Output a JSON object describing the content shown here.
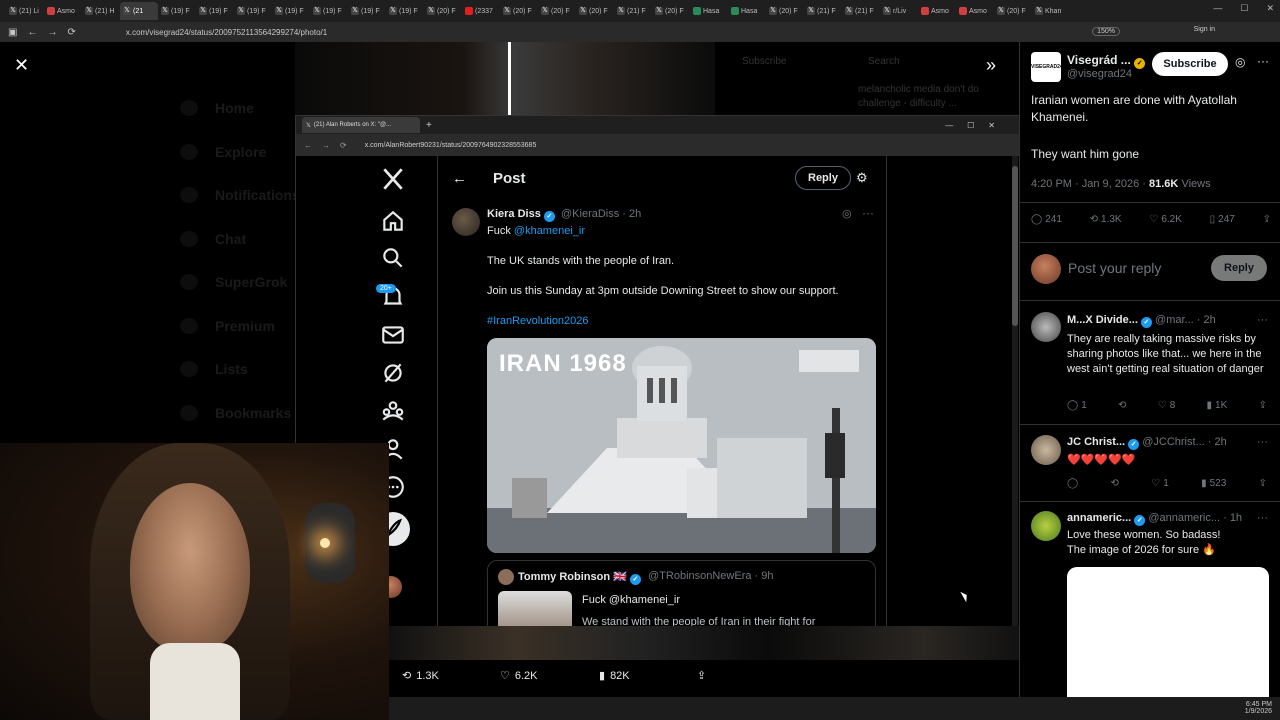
{
  "browser": {
    "tabs": [
      {
        "label": "(21) Li"
      },
      {
        "label": "Asmo"
      },
      {
        "label": "(21) H"
      },
      {
        "label": "(21"
      },
      {
        "label": "(19) F"
      },
      {
        "label": "(19) F"
      },
      {
        "label": "(19) F"
      },
      {
        "label": "(19) F"
      },
      {
        "label": "(19) F"
      },
      {
        "label": "(19) F"
      },
      {
        "label": "(19) F"
      },
      {
        "label": "(20) F"
      },
      {
        "label": "(2337"
      },
      {
        "label": "(20) F"
      },
      {
        "label": "(20) F"
      },
      {
        "label": "(20) F"
      },
      {
        "label": "(21) F"
      },
      {
        "label": "(20) F"
      },
      {
        "label": "Hasa"
      },
      {
        "label": "Hasa"
      },
      {
        "label": "(20) F"
      },
      {
        "label": "(21) F"
      },
      {
        "label": "(21) F"
      },
      {
        "label": "r/Liv"
      },
      {
        "label": "Asmo"
      },
      {
        "label": "Asmo"
      },
      {
        "label": "(20) F"
      },
      {
        "label": "Khan"
      }
    ],
    "url": "x.com/visegrad24/status/2009752113564299274/photo/1",
    "zoom": "150%",
    "sign_in": "Sign in"
  },
  "ghost_nav": [
    "Home",
    "Explore",
    "Notifications",
    "Chat",
    "SuperGrok",
    "Premium",
    "Lists",
    "Bookmarks"
  ],
  "ghost_right": {
    "subscribe": "Subscribe",
    "search": "Search",
    "line1": "melancholic media don't do",
    "line2": "challenge - difficulty ..."
  },
  "inner_browser": {
    "tab_title": "(21) Alan Roberts on X: \"@...",
    "url": "x.com/AlanRobert90231/status/2009764902328553685"
  },
  "inner_sidebar": {
    "badge": "20+"
  },
  "post": {
    "header_title": "Post",
    "reply_label": "Reply",
    "author_name": "Kiera Diss",
    "author_handle": "@KieraDiss",
    "time": "· 2h",
    "line1_prefix": "Fuck",
    "line1_mention": "@khamenei_ir",
    "body1": "The UK stands with the people of Iran.",
    "body2": "Join us this Sunday at 3pm outside Downing Street to show our support.",
    "hashtag": "#IranRevolution2026",
    "media_title": "IRAN 1968",
    "quote": {
      "name": "Tommy Robinson 🇬🇧",
      "handle": "@TRobinsonNewEra · 9h",
      "text": "Fuck @khamenei_ir",
      "text2": "We stand with the people of Iran in their fight for"
    }
  },
  "bottom_actions": {
    "reposts": "1.3K",
    "likes": "6.2K",
    "views": "82K"
  },
  "right_panel": {
    "account_name": "Visegrád ...",
    "account_handle": "@visegrad24",
    "logo_text": "VISEGRAD24",
    "subscribe": "Subscribe",
    "tweet_line1": "Iranian women are done with Ayatollah Khamenei.",
    "tweet_line2": "They want him gone",
    "meta_time": "4:20 PM · Jan 9, 2026 ·",
    "meta_views": "81.6K",
    "meta_views_label": "Views",
    "stats": {
      "replies": "241",
      "reposts": "1.3K",
      "likes": "6.2K",
      "bookmarks": "247"
    },
    "reply_placeholder": "Post your reply",
    "reply_button": "Reply",
    "replies": [
      {
        "name": "M...X Divide...",
        "handle": "@mar...",
        "time": "· 2h",
        "text": "They are really taking massive risks by sharing photos like that... we here in the west ain't getting real situation of danger",
        "comments": "1",
        "reposts": "",
        "likes": "8",
        "views": "1K"
      },
      {
        "name": "JC Christ...",
        "handle": "@JCChrist...",
        "time": "· 2h",
        "text": "❤️❤️❤️❤️❤️",
        "comments": "",
        "reposts": "",
        "likes": "1",
        "views": "523"
      },
      {
        "name": "annameric...",
        "handle": "@annameric...",
        "time": "· 1h",
        "text": "Love these women. So badass!",
        "text2": "The image of 2026 for sure 🔥"
      }
    ]
  },
  "taskbar": {
    "time": "6:45 PM",
    "date": "1/9/2026"
  },
  "colors": {
    "accent": "#1d9bf0",
    "muted": "#71767b",
    "text": "#e7e9ea",
    "background": "#000000",
    "gold": "#e6b400"
  }
}
